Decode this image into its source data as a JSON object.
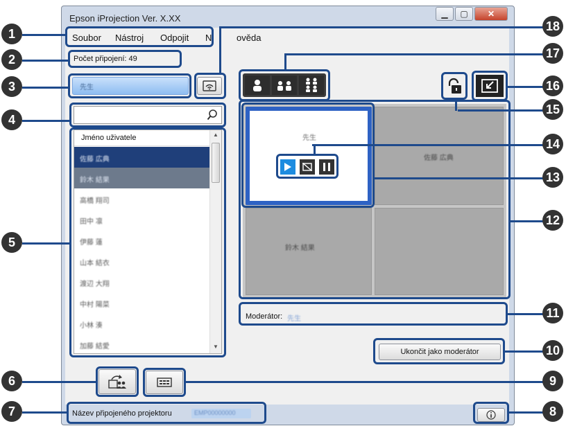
{
  "window": {
    "title": "Epson iProjection Ver. X.XX"
  },
  "menu": {
    "items": [
      "Soubor",
      "Nástroj",
      "Odpojit",
      "N",
      "ověda"
    ]
  },
  "connections": {
    "label": "Počet připojení: 49"
  },
  "moderator_user": {
    "name": "先生"
  },
  "search": {
    "value": "",
    "placeholder": ""
  },
  "user_list": {
    "header": "Jméno uživatele",
    "users": [
      "佐藤 広典",
      "鈴木 結果",
      "高橋 翔司",
      "田中 凛",
      "伊藤 蓮",
      "山本 結衣",
      "渡辺 大翔",
      "中村 陽菜",
      "小林 湊",
      "加藤 結愛"
    ]
  },
  "layout_buttons": [
    "1-screen",
    "2-screen",
    "4-screen"
  ],
  "tiles": {
    "selected": "先生",
    "top_right": "佐藤 広典",
    "bottom_left": "鈴木 結果"
  },
  "moderator": {
    "label": "Moderátor:",
    "name": "先生"
  },
  "end_moderator_button": "Ukončit jako moderátor",
  "projector": {
    "label": "Název připojeného projektoru",
    "name": "EMP00000000"
  },
  "callouts": [
    "1",
    "2",
    "3",
    "4",
    "5",
    "6",
    "7",
    "8",
    "9",
    "10",
    "11",
    "12",
    "13",
    "14",
    "15",
    "16",
    "17",
    "18"
  ],
  "colors": {
    "accent": "#1e4a8c",
    "selected_user": "#2a4a8a",
    "callout": "#333333",
    "tile": "#a9a9a9"
  },
  "icons": [
    "wifi-icon",
    "search-icon",
    "play-icon",
    "blank-icon",
    "pause-icon",
    "lock-icon",
    "exit-fullscreen-icon",
    "user-share-icon",
    "thumbnail-icon",
    "info-icon"
  ]
}
